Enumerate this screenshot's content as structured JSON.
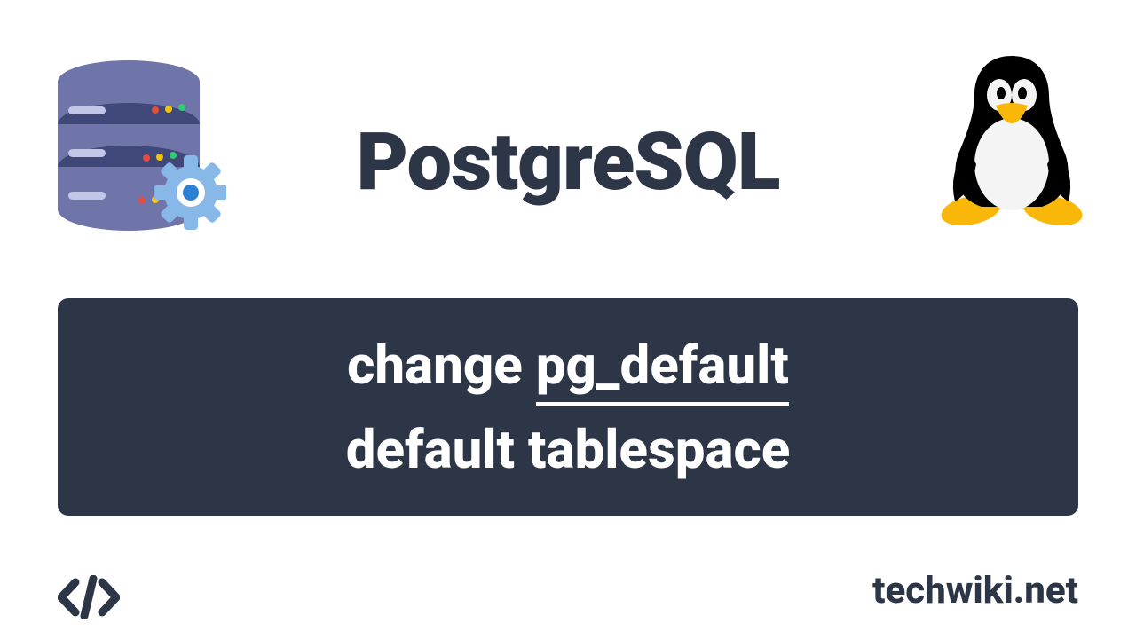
{
  "title": "PostgreSQL",
  "card": {
    "line1_prefix": "change ",
    "line1_underlined": "pg_default",
    "line2": "default tablespace"
  },
  "brand": "techwiki.net",
  "colors": {
    "dark": "#2d3647",
    "db_purple": "#6f75a8",
    "db_dark": "#3f4879",
    "gear_blue": "#87b8e8",
    "gear_inner": "#2b80d4",
    "dot_red": "#e74c3c",
    "dot_yellow": "#f1c40f",
    "dot_green": "#2ecc71",
    "tux_yellow": "#f9b709",
    "tux_white": "#f4f4f4"
  }
}
